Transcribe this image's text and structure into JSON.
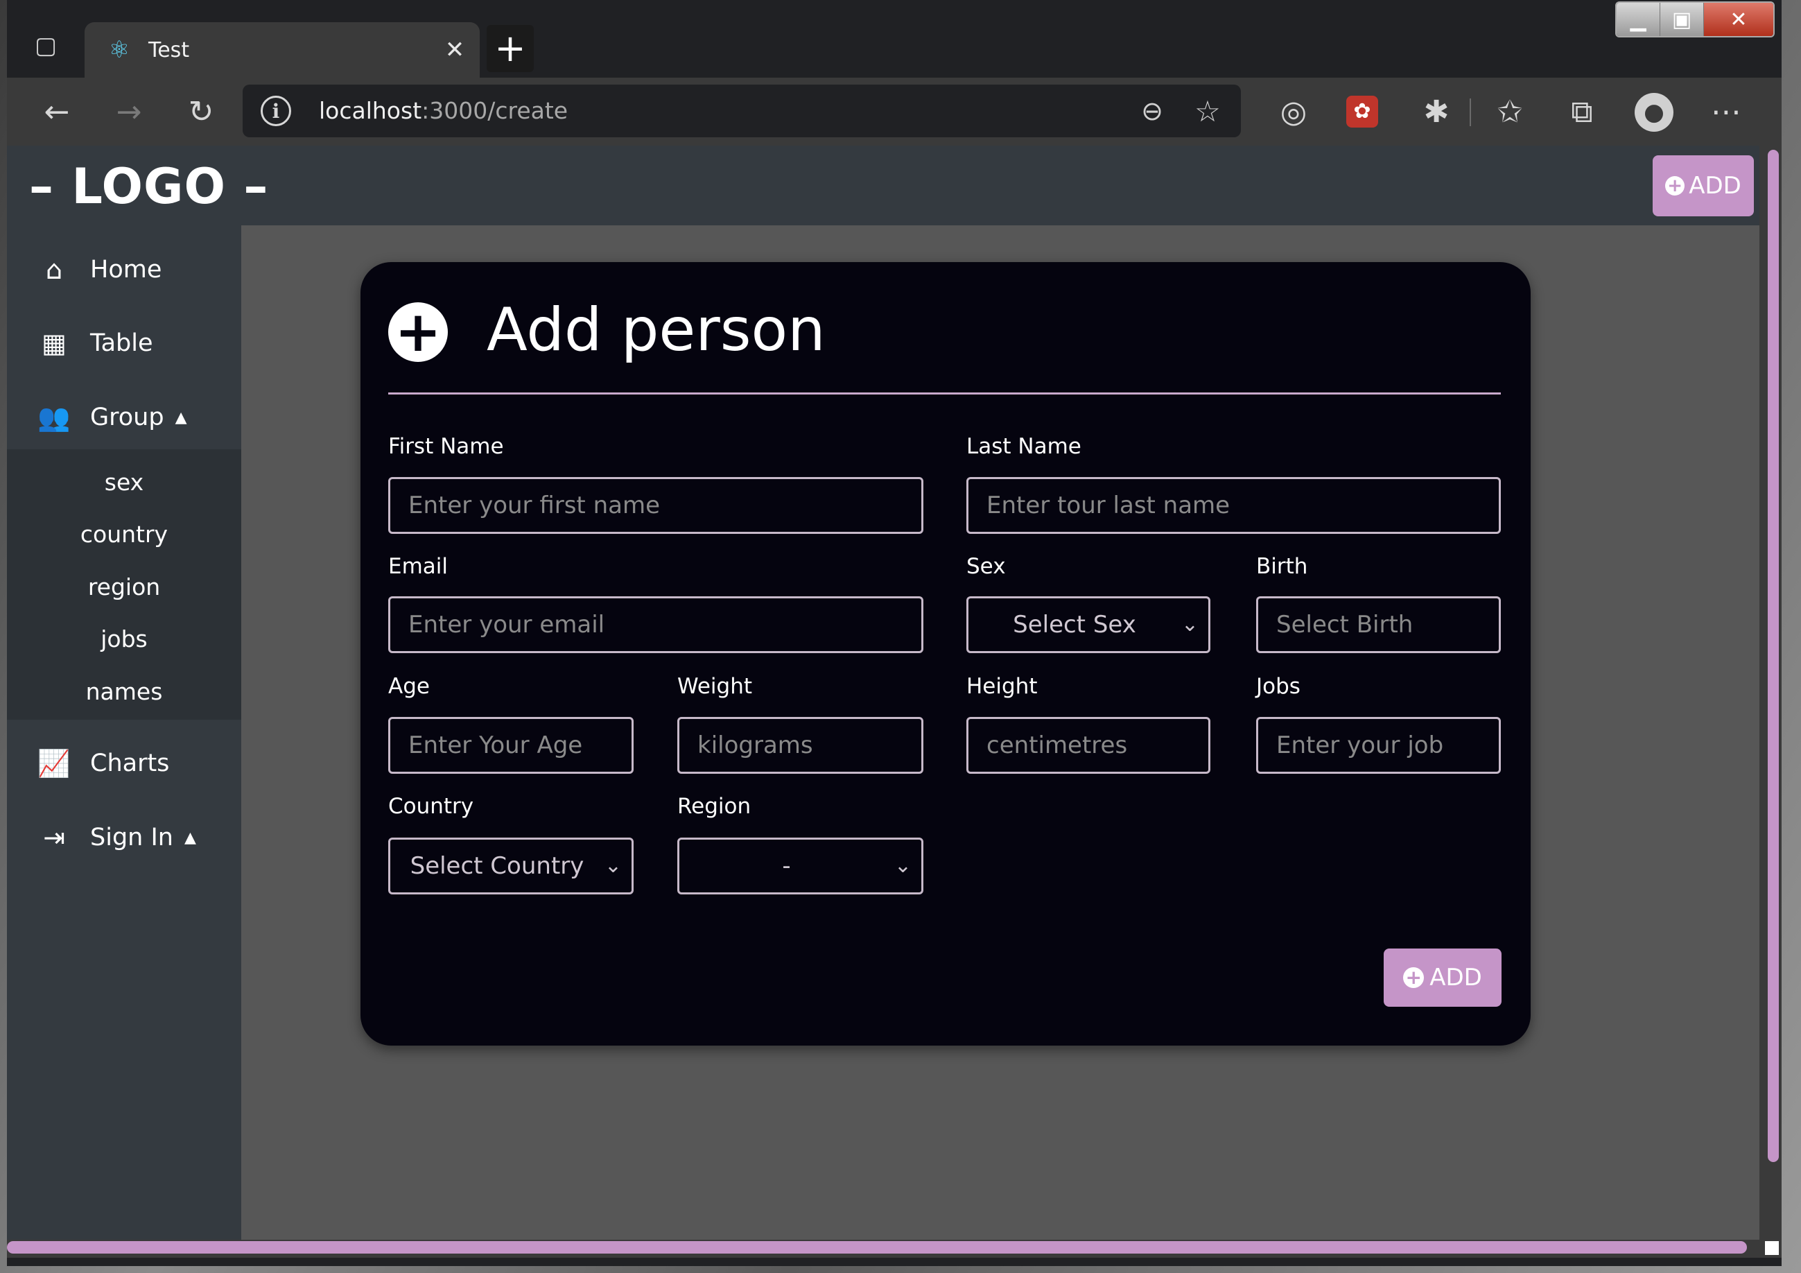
{
  "browser": {
    "tab_title": "Test",
    "close_glyph": "✕",
    "new_tab_glyph": "+",
    "url_host": "localhost",
    "url_path": ":3000/create"
  },
  "header": {
    "logo": "– LOGO –",
    "add_label": "ADD"
  },
  "sidebar": {
    "items": [
      {
        "label": "Home",
        "icon": "home-icon"
      },
      {
        "label": "Table",
        "icon": "table-icon"
      },
      {
        "label": "Group",
        "icon": "users-icon",
        "caret": "▲"
      },
      {
        "label": "Charts",
        "icon": "chart-line-icon"
      },
      {
        "label": "Sign In",
        "icon": "sign-in-icon",
        "caret": "▲"
      }
    ],
    "group_sub_items": [
      "sex",
      "country",
      "region",
      "jobs",
      "names"
    ]
  },
  "form": {
    "title": "Add person",
    "first_name": {
      "label": "First Name",
      "placeholder": "Enter your first name"
    },
    "last_name": {
      "label": "Last Name",
      "placeholder": "Enter tour last name"
    },
    "email": {
      "label": "Email",
      "placeholder": "Enter your email"
    },
    "sex": {
      "label": "Sex",
      "selected": "Select Sex"
    },
    "birth": {
      "label": "Birth",
      "placeholder": "Select Birth"
    },
    "age": {
      "label": "Age",
      "placeholder": "Enter Your Age"
    },
    "weight": {
      "label": "Weight",
      "placeholder": "kilograms"
    },
    "height": {
      "label": "Height",
      "placeholder": "centimetres"
    },
    "jobs": {
      "label": "Jobs",
      "placeholder": "Enter your job"
    },
    "country": {
      "label": "Country",
      "selected": "Select Country"
    },
    "region": {
      "label": "Region",
      "selected": "-"
    },
    "submit_label": "ADD"
  },
  "colors": {
    "accent": "#c595c8",
    "card_bg": "#05040f",
    "sidebar_bg": "#343a40",
    "page_bg": "#575757"
  }
}
